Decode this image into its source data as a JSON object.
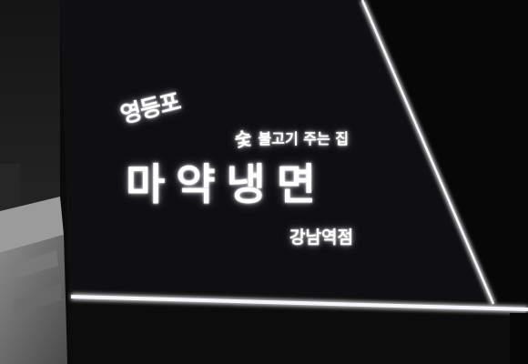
{
  "sign": {
    "district": "영등포",
    "slogan_mark": "숯",
    "slogan": "불고기 주는 집",
    "brand": "마약냉면",
    "branch": "강남역점"
  },
  "colors": {
    "background": "#0a0a0b",
    "panel": "#0e0e10",
    "light_strip": "#f4f4f8",
    "wall": "#3b3b3b",
    "stair": "#6d6d6d"
  }
}
